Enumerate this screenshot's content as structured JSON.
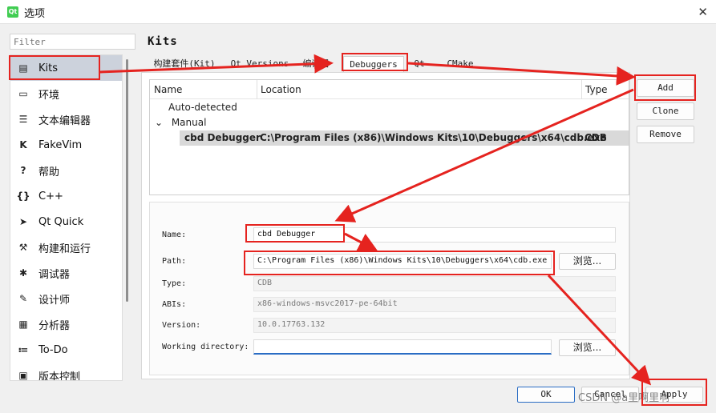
{
  "window": {
    "title": "选项",
    "app_icon_text": "Qt",
    "close_glyph": "✕"
  },
  "filter": {
    "placeholder": "Filter"
  },
  "sidebar": {
    "items": [
      {
        "label": "Kits",
        "icon": "kits-icon",
        "glyph": "▤"
      },
      {
        "label": "环境",
        "icon": "monitor-icon",
        "glyph": "▭"
      },
      {
        "label": "文本编辑器",
        "icon": "text-editor-icon",
        "glyph": "☰"
      },
      {
        "label": "FakeVim",
        "icon": "fakevim-icon",
        "glyph": "K"
      },
      {
        "label": "帮助",
        "icon": "help-icon",
        "glyph": "?"
      },
      {
        "label": "C++",
        "icon": "braces-icon",
        "glyph": "{}"
      },
      {
        "label": "Qt Quick",
        "icon": "qt-quick-icon",
        "glyph": "➤"
      },
      {
        "label": "构建和运行",
        "icon": "hammer-icon",
        "glyph": "⚒"
      },
      {
        "label": "调试器",
        "icon": "bug-icon",
        "glyph": "✱"
      },
      {
        "label": "设计师",
        "icon": "pen-icon",
        "glyph": "✎"
      },
      {
        "label": "分析器",
        "icon": "analyzer-icon",
        "glyph": "▦"
      },
      {
        "label": "To-Do",
        "icon": "todo-list-icon",
        "glyph": "≔"
      },
      {
        "label": "版本控制",
        "icon": "version-control-icon",
        "glyph": "▣"
      }
    ]
  },
  "page": {
    "heading": "Kits"
  },
  "tabs": [
    {
      "label": "构建套件(Kit)"
    },
    {
      "label": "Qt Versions"
    },
    {
      "label": "编译器"
    },
    {
      "label": "Debuggers"
    },
    {
      "label": "Qt"
    },
    {
      "label": "CMake"
    }
  ],
  "tree": {
    "columns": [
      "Name",
      "Location",
      "Type"
    ],
    "groups": [
      "Auto-detected",
      "Manual"
    ],
    "expand_glyph": "⌄",
    "row": {
      "name": "cbd Debugger",
      "location": "C:\\Program Files (x86)\\Windows Kits\\10\\Debuggers\\x64\\cdb.exe",
      "type": "CDB"
    }
  },
  "buttons": {
    "add": "Add",
    "clone": "Clone",
    "remove": "Remove",
    "browse": "浏览...",
    "ok": "OK",
    "cancel": "Cancel",
    "apply": "Apply"
  },
  "details": {
    "name_label": "Name:",
    "name_value": "cbd Debugger",
    "path_label": "Path:",
    "path_value": "C:\\Program Files (x86)\\Windows Kits\\10\\Debuggers\\x64\\cdb.exe",
    "type_label": "Type:",
    "type_value": "CDB",
    "abis_label": "ABIs:",
    "abis_value": "x86-windows-msvc2017-pe-64bit",
    "version_label": "Version:",
    "version_value": "10.0.17763.132",
    "workdir_label": "Working directory:",
    "workdir_value": ""
  },
  "watermark": "CSDN @a里啊里啊",
  "colors": {
    "highlight": "#e5231f",
    "selection": "#ccd2dc",
    "accent": "#2a6dc4"
  }
}
